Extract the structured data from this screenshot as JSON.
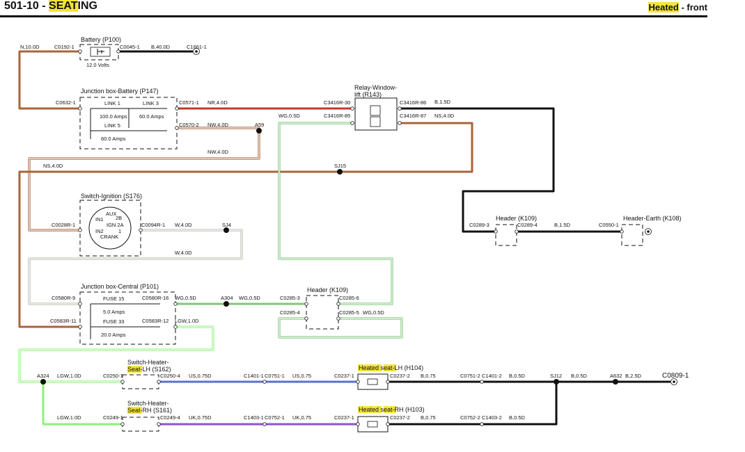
{
  "header": {
    "code": "501-10 - ",
    "section_hl": "SEAT",
    "section_rest": "ING",
    "sub_hl": "Heated",
    "sub_rest": " - front"
  },
  "wires": {
    "n10": "N,10.0D",
    "b40": "B,40.0D",
    "nr40": "NR,4.0D",
    "nw40a": "NW,4.0D",
    "nw40b": "NW,4.0D",
    "ns40a": "NS,4.0D",
    "ns40b": "NS,4.0D",
    "wg05a": "WG,0.5D",
    "wg05b": "WG,0.5D",
    "wg05c": "WG,0.5D",
    "wg05d": "WG,0.5D",
    "b15a": "B,1.5D",
    "b15b": "B,1.5D",
    "w40a": "W,4.0D",
    "w40b": "W,4.0D",
    "lgw10a": "LGW,1.0D",
    "lgw10b": "LGW,1.0D",
    "lgw10c": "LGW,1.0D",
    "us075d": "US,0.75D",
    "us075": "US,0.75",
    "uk075d": "UK,0.75D",
    "uk075": "UK,0.75",
    "b075a": "B,0.75",
    "b075b": "B,0.75",
    "b05a": "B,0.5D",
    "b05b": "B,0.5D",
    "b05c": "B,0.5D",
    "b25": "B,2.5D"
  },
  "connectors": {
    "c0192": "C0192-1",
    "c0045": "C0045-1",
    "c1661": "C1661-1",
    "c0632": "C0632-1",
    "c0571": "C0571-1",
    "c0570": "C0570-2",
    "c3416_30": "C3416R-30",
    "c3416_85": "C3416R-85",
    "c3416_86": "C3416R-86",
    "c3416_87": "C3416R-87",
    "c0028": "C0028R-1",
    "c0094": "C0094R-1",
    "c0289_3": "C0289-3",
    "c0289_4": "C0289-4",
    "c0550": "C0550-1",
    "c0580_9": "C0580R-9",
    "c0580_16": "C0580R-16",
    "c0583_11": "C0583R-11",
    "c0583_12": "C0583R-12",
    "c0285_3": "C0285-3",
    "c0285_6": "C0285-6",
    "c0285_4": "C0285-4",
    "c0285_5": "C0285-5",
    "c0250_1": "C0250-1",
    "c0250_4": "C0250-4",
    "c1401_1": "C1401-1",
    "c0751_1": "C0751-1",
    "c0237_1a": "C0237-1",
    "c0237_2a": "C0237-2",
    "c0751_2": "C0751-2",
    "c1401_2": "C1401-2",
    "c0809": "C0809-1",
    "c0249_1": "C0249-1",
    "c0249_4": "C0249-4",
    "c1403_1": "C1403-1",
    "c0752_1": "C0752-1",
    "c0237_1b": "C0237-1",
    "c0237_2b": "C0237-2",
    "c0752_2": "C0752-2",
    "c1403_2": "C1403-2"
  },
  "splices": {
    "a59": "A59",
    "sj15": "SJ15",
    "sj4": "SJ4",
    "a304": "A304",
    "a324": "A324",
    "sj12": "SJ12",
    "a632": "A632"
  },
  "components": {
    "battery": "Battery (P100)",
    "battery_volts": "12.0 Volts",
    "jb_battery": "Junction box-Battery (P147)",
    "link1": "LINK 1",
    "link1_amps": "100.0 Amps",
    "link3": "LINK 3",
    "link3_amps": "60.0 Amps",
    "link5": "LINK 5",
    "link5_amps": "60.0 Amps",
    "relay_l1": "Relay-Window-",
    "relay_l2": "lift (R143)",
    "ignition": "Switch-Ignition (S176)",
    "ign_aux": "AUX",
    "ign_in1": "IN1",
    "ign_2b": "2B",
    "ign_2a": "IGN 2A",
    "ign_in2": "IN2",
    "ign_1": "1",
    "ign_crank": "CRANK",
    "header_k109a": "Header (K109)",
    "header_earth": "Header-Earth (K108)",
    "header_k109b": "Header (K109)",
    "jb_central": "Junction box-Central (P101)",
    "fuse15": "FUSE 15",
    "fuse15_amps": "5.0 Amps",
    "fuse33": "FUSE 33",
    "fuse33_amps": "20.0 Amps",
    "sw_lh_l1": "Switch-Heater-",
    "sw_lh_hl": "Seat",
    "sw_lh_rest": "-LH (S162)",
    "sw_rh_l1": "Switch-Heater-",
    "sw_rh_hl": "Seat",
    "sw_rh_rest": "-RH (S161)",
    "seat_lh_hl1": "Heated",
    "seat_lh_mid": " ",
    "seat_lh_hl2": "seat",
    "seat_lh_rest": "-LH (H104)",
    "seat_rh_hl1": "Heated",
    "seat_rh_mid": " ",
    "seat_rh_hl2": "seat",
    "seat_rh_rest": "-RH (H103)"
  },
  "colors": {
    "brown": "#a8643a",
    "red": "#c0392b",
    "black": "#111111",
    "green": "#7dc77a",
    "lightgreen": "#8ef07a",
    "blue": "#5a6fd0",
    "purple": "#8c52d0",
    "cream": "#bdbcb0",
    "highlight": "#f4e43a"
  }
}
